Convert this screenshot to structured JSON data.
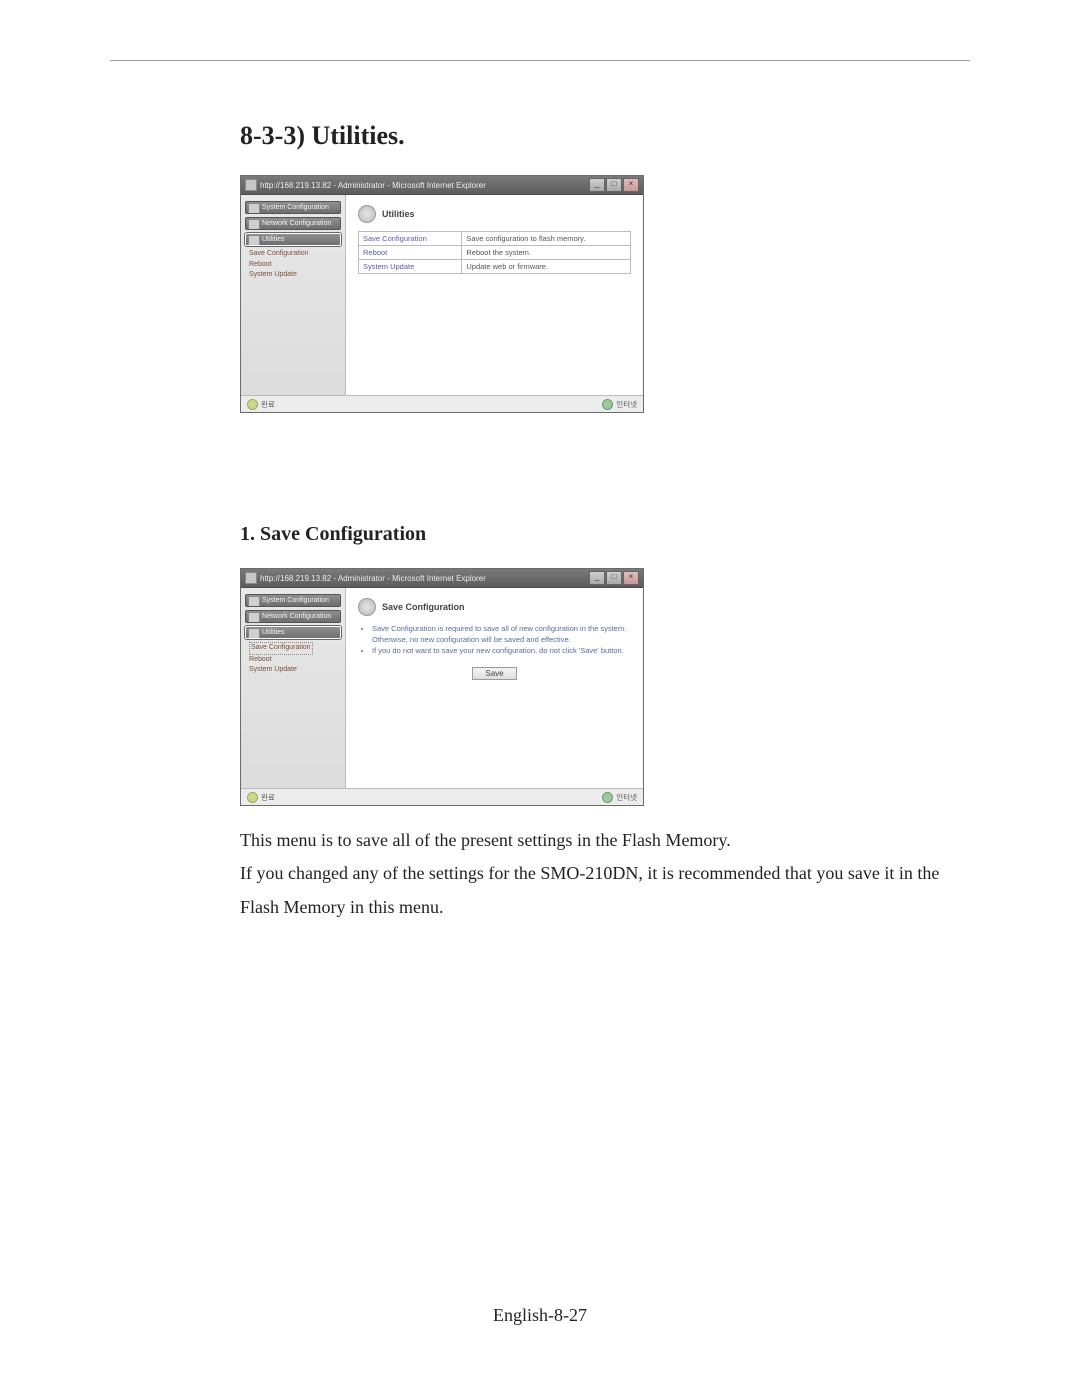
{
  "section_heading": "8-3-3) Utilities.",
  "sub_heading": "1. Save Configuration",
  "body_text_1": "This menu is to save all of the present settings in the Flash Memory.",
  "body_text_2": "If you changed any of the settings for the SMO-210DN, it is recommended that you save it in the Flash Memory in this menu.",
  "page_number": "English-8-27",
  "win1": {
    "title": "http://168.219.13.82 - Administrator - Microsoft Internet Explorer",
    "sidebar": {
      "system_config": "System Configuration",
      "network_config": "Network Configuration",
      "utilities": "Utilities",
      "sub_save": "Save Configuration",
      "sub_reboot": "Reboot",
      "sub_update": "System Update"
    },
    "pane_title": "Utilities",
    "rows": {
      "r1a": "Save Configuration",
      "r1b": "Save configuration to flash memory.",
      "r2a": "Reboot",
      "r2b": "Reboot the system.",
      "r3a": "System Update",
      "r3b": "Update web or firmware."
    },
    "status_left": "완료",
    "status_right": "인터넷"
  },
  "win2": {
    "title": "http://168.219.13.82 - Administrator - Microsoft Internet Explorer",
    "sidebar": {
      "system_config": "System Configuration",
      "network_config": "Network Configuration",
      "utilities": "Utilities",
      "sub_save": "Save Configuration",
      "sub_reboot": "Reboot",
      "sub_update": "System Update"
    },
    "pane_title": "Save Configuration",
    "bullets": {
      "b1": "Save Configuration is required to save all of new configuration in the system. Otherwise, no new configuration will be saved and effective.",
      "b2": "If you do not want to save your new configuration, do not click 'Save' button."
    },
    "save_button": "Save",
    "status_left": "완료",
    "status_right": "인터넷"
  }
}
